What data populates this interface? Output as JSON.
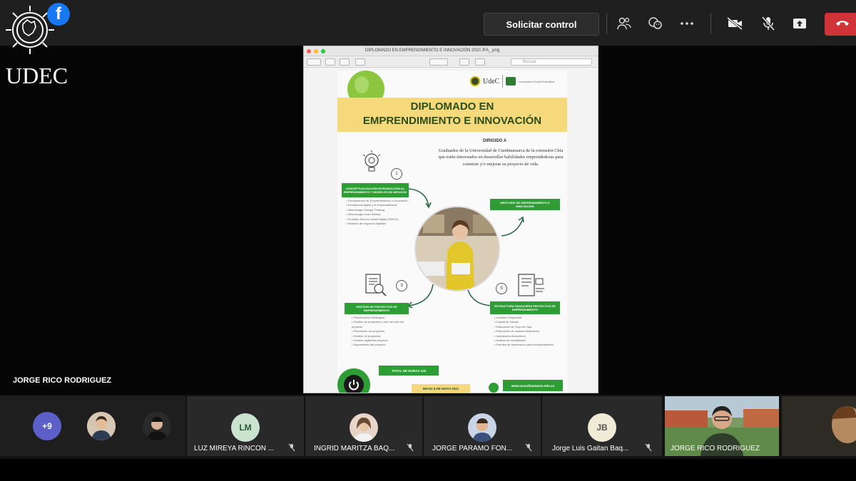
{
  "toolbar": {
    "request_control_label": "Solicitar control",
    "icons": [
      "people-icon",
      "reactions-icon",
      "more-icon",
      "camera-off-icon",
      "mic-off-icon",
      "share-tray-icon",
      "hang-up-icon"
    ],
    "hangup_color": "#d13438"
  },
  "logo": {
    "text": "UDEC",
    "facebook_letter": "f"
  },
  "presenter": {
    "name": "JORGE RICO RODRIGUEZ"
  },
  "shared_window": {
    "title": "DIPLOMADO EN EMPRENDIMIENTO E INNOVACIÓN 2021 IFA_.png",
    "search_placeholder": "Buscar",
    "poster": {
      "logo_name": "UdeC",
      "logo_sub": "Innovación Social Educativa",
      "title_line1": "DIPLOMADO EN",
      "title_line2": "EMPRENDIMIENTO E INNOVACIÓN",
      "dirigido": "DIRIGIDO A",
      "dirigido_text": "Graduados de la Universidad de Cundinamarca de la extensión Chía que estén interesados en desarrollar habilidades emprendedoras para construir y/o mejorar su proyecto de vida.",
      "module1": "CONCEPTUALIZACIÓN INTRODUCCIÓN AL EMPRENDIMIENTO Y MODELOS DE NEGOCIO",
      "module2": "MENTORÍA DE EMPRENDIMIENTO E INNOVACIÓN",
      "module3": "GESTIÓN DE PROYECTOS DE EMPRENDIMIENTO",
      "module4": "ESTRUCTURA FINANCIERA PROYECTOS DE EMPRENDIMIENTO",
      "num1": "1",
      "num3": "3",
      "num5": "5",
      "bullets1": [
        "Fundamentos de Emprendimiento e Innovación",
        "Ecosistema digital y el emprendimiento",
        "Metodología Design Thinking",
        "Metodología Lean Startup",
        "Prototipo Mínimo Viable Digital (PMV-D)",
        "Modelos de negocios digitales"
      ],
      "bullets3": [
        "Planificación Estratégica",
        "Gestión de proyectos y ciclo de vida del proyecto",
        "Planeación de proyectos",
        "Gestión de proyectos",
        "Gestión digital del proyecto",
        "Seguimiento del proyecto"
      ],
      "bullets4": [
        "Inversión Requerida",
        "Capital de trabajo",
        "Estimación de Flujo de Caja",
        "Estimación de estados financieros",
        "Indicadores financieros",
        "Análisis de sensibilidad",
        "Fuentes de financiación para emprendedores"
      ],
      "total_horas": "TOTAL DE HORAS 120",
      "inicio": "INICIO 8 DE MAYO 2021",
      "web": "www.ucundinamarca.edu.co"
    }
  },
  "participants": {
    "overflow_count": "+9",
    "tiles": [
      {
        "initials": "LM",
        "name": "LUZ MIREYA RINCON ...",
        "avatar_bg": "#c9e3cf",
        "avatar_fg": "#2d5a3a"
      },
      {
        "initials": "",
        "name": "INGRID MARITZA BAQ...",
        "avatar_bg": "#e6d5c8",
        "avatar_fg": "#333"
      },
      {
        "initials": "",
        "name": "JORGE PARAMO FON...",
        "avatar_bg": "#c9d4e6",
        "avatar_fg": "#333"
      },
      {
        "initials": "JB",
        "name": "Jorge Luis Gaitan Baq...",
        "avatar_bg": "#f0ebd6",
        "avatar_fg": "#555"
      },
      {
        "initials": "",
        "name": "JORGE RICO RODRIGUEZ",
        "avatar_bg": "#6a8f5a",
        "avatar_fg": "#fff"
      }
    ]
  }
}
